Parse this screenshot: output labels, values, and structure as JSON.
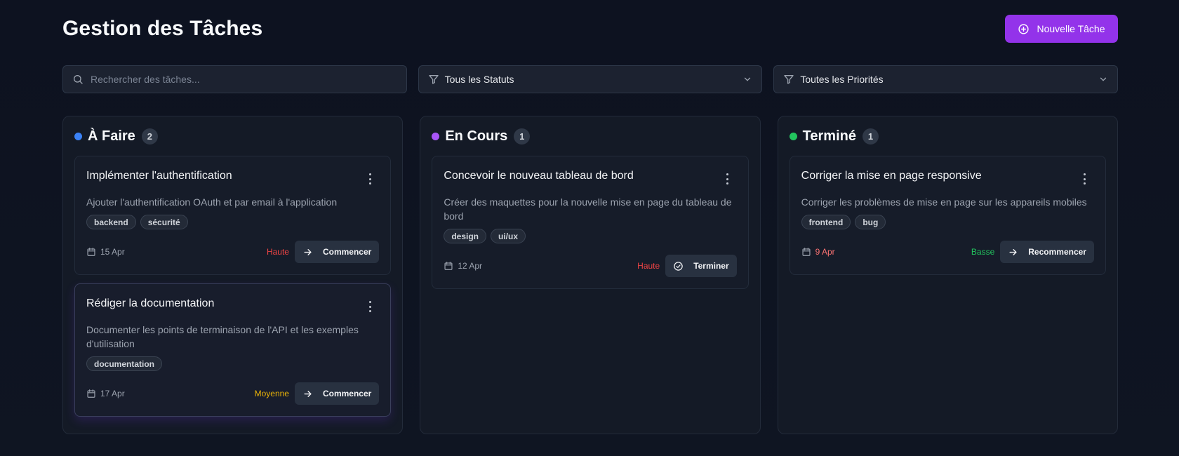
{
  "header": {
    "title": "Gestion des Tâches",
    "new_task_label": "Nouvelle Tâche"
  },
  "filters": {
    "search_placeholder": "Rechercher des tâches...",
    "status_value": "Tous les Statuts",
    "priority_value": "Toutes les Priorités"
  },
  "colors": {
    "todo": "#3b82f6",
    "in_progress": "#a855f7",
    "done": "#22c55e",
    "accent": "#9333ea"
  },
  "columns": [
    {
      "title": "À Faire",
      "count": "2",
      "cards": [
        {
          "title": "Implémenter l'authentification",
          "description": "Ajouter l'authentification OAuth et par email à l'application",
          "tags": [
            "backend",
            "sécurité"
          ],
          "date": "15 Apr",
          "priority": "Haute",
          "action": "Commencer"
        },
        {
          "title": "Rédiger la documentation",
          "description": "Documenter les points de terminaison de l'API et les exemples d'utilisation",
          "tags": [
            "documentation"
          ],
          "date": "17 Apr",
          "priority": "Moyenne",
          "action": "Commencer"
        }
      ]
    },
    {
      "title": "En Cours",
      "count": "1",
      "cards": [
        {
          "title": "Concevoir le nouveau tableau de bord",
          "description": "Créer des maquettes pour la nouvelle mise en page du tableau de bord",
          "tags": [
            "design",
            "ui/ux"
          ],
          "date": "12 Apr",
          "priority": "Haute",
          "action": "Terminer"
        }
      ]
    },
    {
      "title": "Terminé",
      "count": "1",
      "cards": [
        {
          "title": "Corriger la mise en page responsive",
          "description": "Corriger les problèmes de mise en page sur les appareils mobiles",
          "tags": [
            "frontend",
            "bug"
          ],
          "date": "9 Apr",
          "priority": "Basse",
          "action": "Recommencer"
        }
      ]
    }
  ]
}
